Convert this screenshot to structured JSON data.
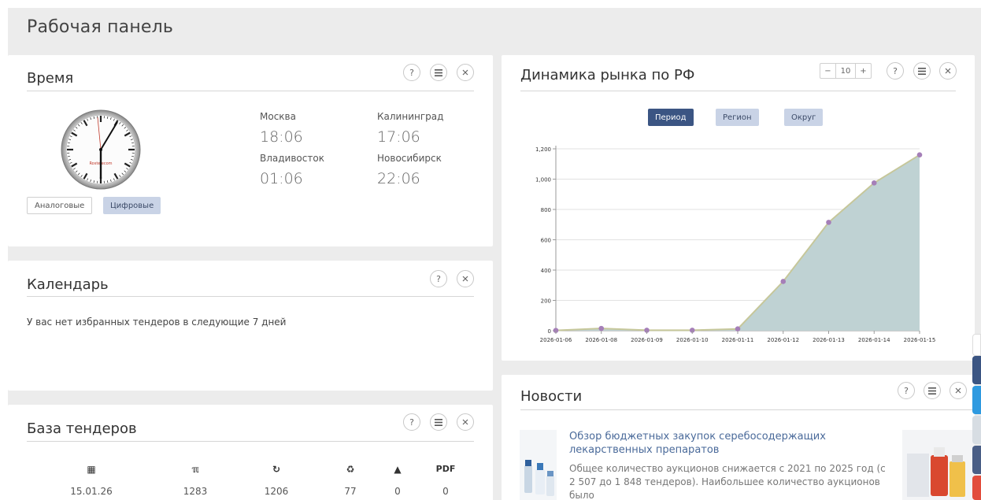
{
  "dashboard": {
    "title": "Рабочая панель"
  },
  "time_panel": {
    "title": "Время",
    "help": "?",
    "clock_brand": "Rostelecom",
    "buttons": {
      "analog": "Аналоговые",
      "digital": "Цифровые"
    },
    "cities": [
      {
        "name": "Москва",
        "time": "18:06"
      },
      {
        "name": "Калининград",
        "time": "17:06"
      },
      {
        "name": "Владивосток",
        "time": "01:06"
      },
      {
        "name": "Новосибирск",
        "time": "22:06"
      }
    ]
  },
  "calendar_panel": {
    "title": "Календарь",
    "help": "?",
    "message": "У вас нет избранных тендеров в следующие 7 дней"
  },
  "tenders_panel": {
    "title": "База тендеров",
    "help": "?",
    "stats": [
      {
        "icon": "calendar-icon",
        "glyph": "▦",
        "value": "15.01.26"
      },
      {
        "icon": "rss-icon",
        "glyph": "ℼ",
        "value": "1283"
      },
      {
        "icon": "history-icon",
        "glyph": "↻",
        "value": "1206"
      },
      {
        "icon": "recycle-icon",
        "glyph": "♻",
        "value": "77"
      },
      {
        "icon": "warning-icon",
        "glyph": "▲",
        "value": "0"
      },
      {
        "icon": "pdf-icon",
        "glyph": "PDF",
        "value": "0"
      }
    ]
  },
  "market_panel": {
    "title": "Динамика рынка по РФ",
    "help": "?",
    "stepper": {
      "minus": "−",
      "value": "10",
      "plus": "+"
    },
    "filters": {
      "period": "Период",
      "region": "Регион",
      "district": "Округ"
    }
  },
  "news_panel": {
    "title": "Новости",
    "help": "?",
    "item": {
      "title": "Обзор бюджетных закупок серебосодержащих лекарственных препаратов",
      "text": "Общее количество аукционов снижается с 2021 по 2025 год (с 2 507 до 1 848 тендеров). Наибольшее количество аукционов было"
    }
  },
  "chart_data": {
    "type": "area",
    "categories": [
      "2026-01-06",
      "2026-01-08",
      "2026-01-09",
      "2026-01-10",
      "2026-01-11",
      "2026-01-12",
      "2026-01-13",
      "2026-01-14",
      "2026-01-15"
    ],
    "values": [
      2,
      15,
      3,
      3,
      12,
      325,
      715,
      975,
      1160
    ],
    "y_ticks": [
      "0",
      "200",
      "400",
      "600",
      "800",
      "1,000",
      "1,200"
    ],
    "ylim": [
      0,
      1200
    ],
    "grid": true,
    "colors": {
      "fill": "#bfd2d3",
      "line": "#c6c79a",
      "point": "#a57fb8"
    }
  },
  "colors": {
    "accent": "#3b5583",
    "soft_button": "#c9d3e6",
    "background": "#ececec"
  }
}
